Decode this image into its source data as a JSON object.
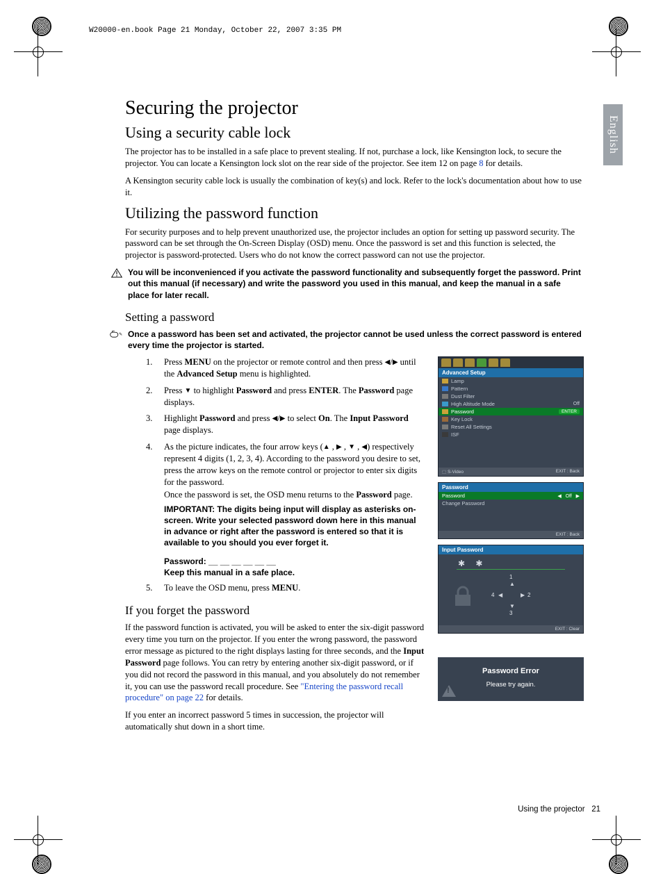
{
  "meta": {
    "header": "W20000-en.book  Page 21  Monday, October 22, 2007  3:35 PM",
    "side_tab": "English",
    "footer_section": "Using the projector",
    "footer_page": "21"
  },
  "headings": {
    "h1": "Securing the projector",
    "h2a": "Using a security cable lock",
    "h2b": "Utilizing the password function",
    "h3a": "Setting a password",
    "h3b": "If you forget the password"
  },
  "paragraphs": {
    "p1a": "The projector has to be installed in a safe place to prevent stealing. If not, purchase a lock, like Kensington lock, to secure the projector. You can locate a Kensington lock slot on the rear side of the projector. See item 12 on page ",
    "p1_link": "8",
    "p1b": " for details.",
    "p2": "A Kensington security cable lock is usually the combination of key(s) and lock. Refer to the lock's documentation about how to use it.",
    "p3": "For security purposes and to help prevent unauthorized use, the projector includes an option for setting up password security. The password can be set through the On-Screen Display (OSD) menu. Once the password is set and this function is selected, the projector is password-protected. Users who do not know the correct password can not use the projector.",
    "warn1": "You will be inconvenienced if you activate the password functionality and subsequently forget the password. Print out this manual (if necessary) and write the password you used in this manual, and keep the manual in a safe place for later recall.",
    "note1": "Once a password has been set and activated, the projector cannot be used unless the correct password is entered every time the projector is started.",
    "important": "IMPORTANT: The digits being input will display as asterisks on-screen. Write your selected password down here in this manual in advance or right after the password is entered so that it is available to you should you ever forget it.",
    "pwline": "Password: __ __ __ __ __ __",
    "keep": "Keep this manual in a safe place.",
    "forgot1a": "If the password function is activated, you will be asked to enter the six-digit password every time you turn on the projector. If you enter the wrong password, the password error message as pictured to the right displays lasting for three seconds, and the ",
    "forgot1b": " page follows. You can retry by entering another six-digit password, or if you did not record the password in this manual, and you absolutely do not remember it, you can use the password recall procedure. See ",
    "forgot_link": "\"Entering the password recall procedure\" on page 22",
    "forgot1c": " for details.",
    "forgot2": "If you enter an incorrect password 5 times in succession, the projector will automatically shut down in a short time."
  },
  "steps": {
    "s1a": "Press ",
    "s1b": " on the projector or remote control and then press ",
    "s1c": " until the ",
    "s1d": " menu is highlighted.",
    "s2a": "Press ",
    "s2b": " to highlight ",
    "s2c": " and press ",
    "s2d": ". The ",
    "s2e": " page displays.",
    "s3a": "Highlight ",
    "s3b": " and press ",
    "s3c": " to select ",
    "s3d": ". The ",
    "s3e": " page displays.",
    "s4a": "As the picture indicates, the four arrow keys (",
    "s4b": ") respectively represent 4 digits (1, 2, 3, 4). According to the password you desire to set, press the arrow keys on the remote control or projector to enter six digits for the password.",
    "s4c": "Once the password is set, the OSD menu returns to the ",
    "s4d": " page.",
    "s5a": "To leave the OSD menu, press ",
    "s5b": "."
  },
  "bold": {
    "menu": "MENU",
    "advsetup": "Advanced Setup",
    "password": "Password",
    "enter": "ENTER",
    "on": "On",
    "inputpw": "Input Password"
  },
  "osd1": {
    "title": "Advanced Setup",
    "items": [
      "Lamp",
      "Pattern",
      "Dust Filter",
      "High Altitude Mode",
      "Password",
      "Key Lock",
      "Reset All Settings",
      "ISF"
    ],
    "off": "Off",
    "enter": "ENTER",
    "src": "S-Video",
    "foot": "EXIT : Back"
  },
  "osd2": {
    "title": "Password",
    "row1": "Password",
    "row1v": "Off",
    "row2": "Change Password",
    "foot": "EXIT : Back"
  },
  "osd3": {
    "title": "Input Password",
    "stars": "✱ ✱",
    "d1": "1",
    "d2": "2",
    "d3": "3",
    "d4": "4",
    "foot": "EXIT : Clear"
  },
  "err": {
    "title": "Password Error",
    "msg": "Please try again."
  }
}
